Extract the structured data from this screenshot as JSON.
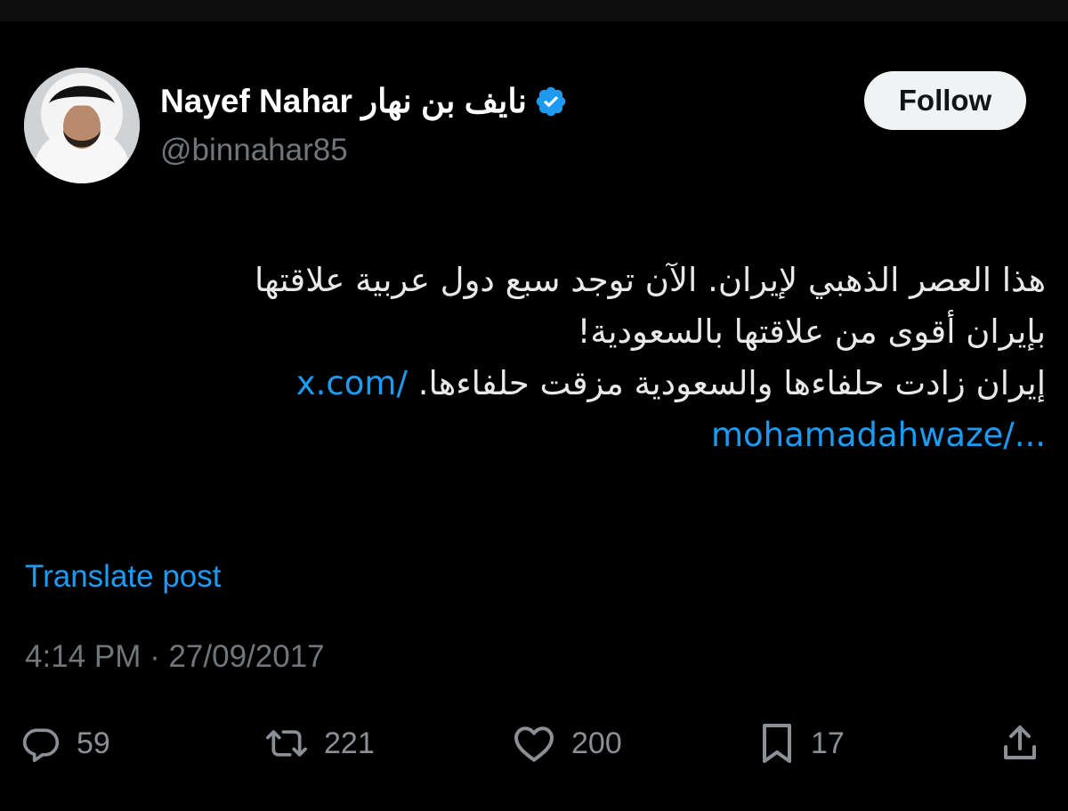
{
  "post": {
    "author": {
      "display_name": "Nayef Nahar نايف بن نهار",
      "handle": "@binnahar85",
      "verified_icon": "verified-badge-icon",
      "avatar": "profile-photo"
    },
    "follow_label": "Follow",
    "body_line_1": "هذا العصر الذهبي لإيران. الآن توجد سبع دول عربية علاقتها",
    "body_line_2": "بإيران أقوى من علاقتها بالسعودية!",
    "body_line_3_text": "إيران زادت حلفاءها والسعودية مزقت حلفاءها.",
    "link_part_1": "x.com/",
    "link_part_2": "mohamadahwaze/...",
    "translate_label": "Translate post",
    "timestamp": "4:14 PM · 27/09/2017",
    "metrics": {
      "replies": "59",
      "reposts": "221",
      "likes": "200",
      "bookmarks": "17"
    }
  },
  "colors": {
    "background": "#000000",
    "text_primary": "#e7e9ea",
    "text_secondary": "#71767b",
    "link": "#1d9bf0",
    "verified": "#1d9bf0",
    "follow_button_bg": "#eff3f4"
  },
  "icons": {
    "reply": "reply-bubble-icon",
    "repost": "repost-arrows-icon",
    "like": "heart-icon",
    "bookmark": "bookmark-icon",
    "share": "share-upload-icon"
  }
}
